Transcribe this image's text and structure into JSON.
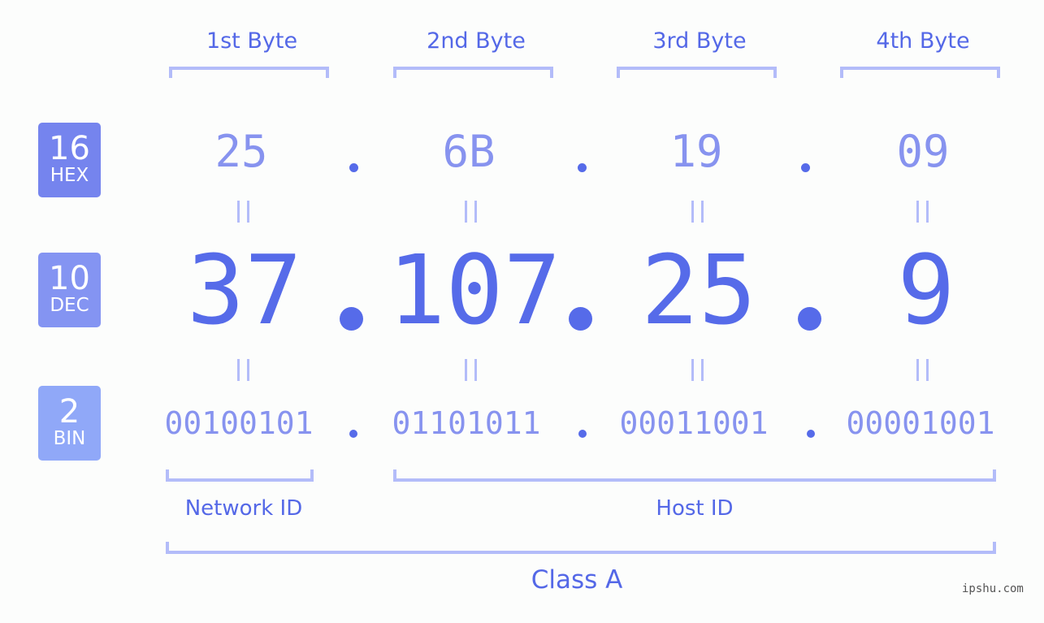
{
  "byte_headers": [
    "1st Byte",
    "2nd Byte",
    "3rd Byte",
    "4th Byte"
  ],
  "bases": [
    {
      "number": "16",
      "label": "HEX",
      "color": "#7584ee"
    },
    {
      "number": "10",
      "label": "DEC",
      "color": "#8494f2"
    },
    {
      "number": "2",
      "label": "BIN",
      "color": "#90a8f8"
    }
  ],
  "ip": {
    "hex": [
      "25",
      "6B",
      "19",
      "09"
    ],
    "dec": [
      "37",
      "107",
      "25",
      "9"
    ],
    "bin": [
      "00100101",
      "01101011",
      "00011001",
      "00001001"
    ],
    "separator": "."
  },
  "segments": {
    "network_id": "Network ID",
    "host_id": "Host ID",
    "class_label": "Class A"
  },
  "watermark": "ipshu.com",
  "colors": {
    "accent": "#566be9",
    "light_accent": "#8793ef",
    "bracket": "#b3bcf9",
    "background": "#fcfdfc"
  }
}
